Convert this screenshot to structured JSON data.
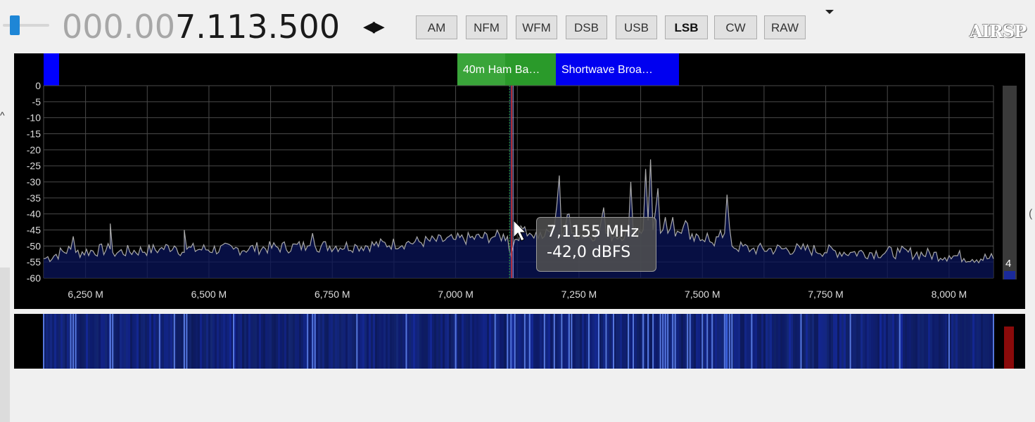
{
  "frequency": {
    "dim": "000.00",
    "main": "7.113.500",
    "step_arrows": "◀▶"
  },
  "modes": [
    {
      "label": "AM",
      "active": false
    },
    {
      "label": "NFM",
      "active": false
    },
    {
      "label": "WFM",
      "active": false
    },
    {
      "label": "DSB",
      "active": false
    },
    {
      "label": "USB",
      "active": false
    },
    {
      "label": "LSB",
      "active": true
    },
    {
      "label": "CW",
      "active": false
    },
    {
      "label": "RAW",
      "active": false
    }
  ],
  "logo": "AIRSP",
  "left_chevron": "^",
  "right_edge_char": "(",
  "band_labels": [
    {
      "text": "40m Ham Ba…",
      "color": "#2a9a2a"
    },
    {
      "text": "Shortwave Broa…",
      "color": "#0000f0"
    }
  ],
  "tooltip": {
    "frequency": "7,1155 MHz",
    "level": "-42,0 dBFS"
  },
  "level_slider": {
    "label": "4"
  },
  "chart_data": {
    "type": "line",
    "title": "",
    "xlabel": "",
    "ylabel": "",
    "x_ticks": [
      "6,250 M",
      "6,500 M",
      "6,750 M",
      "7,000 M",
      "7,250 M",
      "7,500 M",
      "7,750 M",
      "8,000 M"
    ],
    "y_ticks": [
      "0",
      "-5",
      "-10",
      "-15",
      "-20",
      "-25",
      "-30",
      "-35",
      "-40",
      "-45",
      "-50",
      "-55",
      "-60"
    ],
    "xlim_mhz": [
      6.165,
      8.09
    ],
    "ylim_dbfs": [
      -60,
      0
    ],
    "center_mhz": 7.1135,
    "noise_floor_dbfs": -53,
    "grid": true,
    "series": [
      {
        "points_mhz_dbfs": [
          [
            6.165,
            -54
          ],
          [
            6.22,
            -51
          ],
          [
            6.225,
            -47
          ],
          [
            6.23,
            -52
          ],
          [
            6.3,
            -51
          ],
          [
            6.3,
            -43
          ],
          [
            6.305,
            -52
          ],
          [
            6.4,
            -51
          ],
          [
            6.43,
            -50
          ],
          [
            6.45,
            -52
          ],
          [
            6.45,
            -45
          ],
          [
            6.455,
            -51
          ],
          [
            6.55,
            -51
          ],
          [
            6.7,
            -50
          ],
          [
            6.71,
            -46
          ],
          [
            6.715,
            -50
          ],
          [
            6.8,
            -50
          ],
          [
            6.9,
            -49
          ],
          [
            7.0,
            -48
          ],
          [
            7.08,
            -47
          ],
          [
            7.105,
            -47
          ],
          [
            7.112,
            -53
          ],
          [
            7.12,
            -48
          ],
          [
            7.14,
            -44
          ],
          [
            7.15,
            -46
          ],
          [
            7.18,
            -47
          ],
          [
            7.2,
            -44
          ],
          [
            7.21,
            -28
          ],
          [
            7.215,
            -47
          ],
          [
            7.23,
            -40
          ],
          [
            7.235,
            -46
          ],
          [
            7.27,
            -47
          ],
          [
            7.29,
            -46
          ],
          [
            7.3,
            -38
          ],
          [
            7.305,
            -46
          ],
          [
            7.32,
            -47
          ],
          [
            7.35,
            -46
          ],
          [
            7.355,
            -30
          ],
          [
            7.36,
            -46
          ],
          [
            7.38,
            -45
          ],
          [
            7.385,
            -26
          ],
          [
            7.39,
            -42
          ],
          [
            7.395,
            -23
          ],
          [
            7.4,
            -45
          ],
          [
            7.41,
            -32
          ],
          [
            7.415,
            -46
          ],
          [
            7.42,
            -45
          ],
          [
            7.425,
            -41
          ],
          [
            7.43,
            -46
          ],
          [
            7.44,
            -41
          ],
          [
            7.445,
            -47
          ],
          [
            7.47,
            -43
          ],
          [
            7.475,
            -48
          ],
          [
            7.5,
            -48
          ],
          [
            7.51,
            -46
          ],
          [
            7.52,
            -49
          ],
          [
            7.545,
            -46
          ],
          [
            7.55,
            -34
          ],
          [
            7.555,
            -44
          ],
          [
            7.56,
            -50
          ],
          [
            7.6,
            -51
          ],
          [
            7.7,
            -51
          ],
          [
            7.8,
            -52
          ],
          [
            7.9,
            -52
          ],
          [
            8.0,
            -53
          ],
          [
            8.09,
            -54
          ]
        ]
      }
    ]
  }
}
